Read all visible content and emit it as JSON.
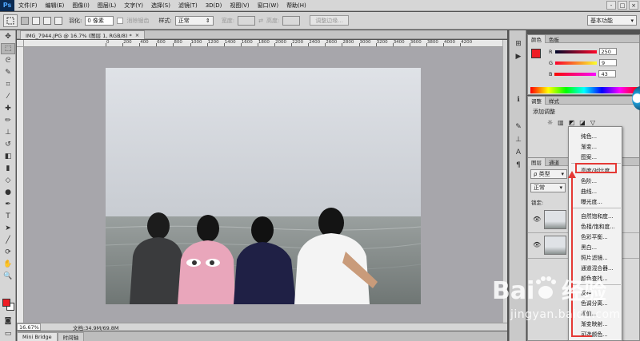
{
  "menubar": {
    "logo": "Ps",
    "items": [
      "文件(F)",
      "编辑(E)",
      "图像(I)",
      "图层(L)",
      "文字(Y)",
      "选择(S)",
      "滤镜(T)",
      "3D(D)",
      "视图(V)",
      "窗口(W)",
      "帮助(H)"
    ],
    "window_controls": [
      "-",
      "□",
      "×"
    ]
  },
  "options": {
    "feather_label": "羽化:",
    "feather_value": "0 像素",
    "antialias_label": "消除锯齿",
    "style_label": "样式:",
    "style_value": "正常",
    "width_label": "宽度:",
    "height_label": "高度:",
    "refine_edge": "调整边缘...",
    "workspace": "基本功能"
  },
  "document": {
    "tab_title": "IMG_7944.JPG @ 16.7% (图层 1, RGB/8) *",
    "tab_close": "×",
    "ruler_ticks": [
      "0",
      "200",
      "400",
      "600",
      "800",
      "1000",
      "1200",
      "1400",
      "1600",
      "1800",
      "2000",
      "2200",
      "2400",
      "2600",
      "2800",
      "3000",
      "3200",
      "3400",
      "3600",
      "3800",
      "4000",
      "4200"
    ],
    "zoom": "16.67%",
    "doc_info": "文档:34.9M/69.8M"
  },
  "bottom_tabs": [
    "Mini Bridge",
    "时间轴"
  ],
  "color_panel": {
    "tabs": [
      "颜色",
      "色板"
    ],
    "r_label": "R",
    "g_label": "G",
    "b_label": "B",
    "r_value": "250",
    "g_value": "9",
    "b_value": "43",
    "fg_color": "#ee1c24"
  },
  "adjust_panel": {
    "tabs": [
      "调整",
      "样式"
    ],
    "title": "添加调整"
  },
  "layers_panel": {
    "tabs": [
      "图层",
      "通道"
    ],
    "filter_label": "ρ 类型",
    "blend_mode": "正常",
    "lock_label": "锁定:"
  },
  "context_menu": {
    "group1": [
      "纯色...",
      "渐变...",
      "图案..."
    ],
    "group2": [
      "亮度/对比度...",
      "色阶...",
      "曲线...",
      "曝光度..."
    ],
    "group3": [
      "自然饱和度...",
      "色相/饱和度...",
      "色彩平衡...",
      "黑白...",
      "照片滤镜...",
      "通道混合器...",
      "颜色查找..."
    ],
    "group4": [
      "反相",
      "色调分离...",
      "阈值...",
      "渐变映射...",
      "可选颜色..."
    ],
    "highlight_color": "#e53935"
  },
  "watermark": {
    "logo_text": "Bai 经验",
    "url": "jingyan.baidu.com"
  }
}
